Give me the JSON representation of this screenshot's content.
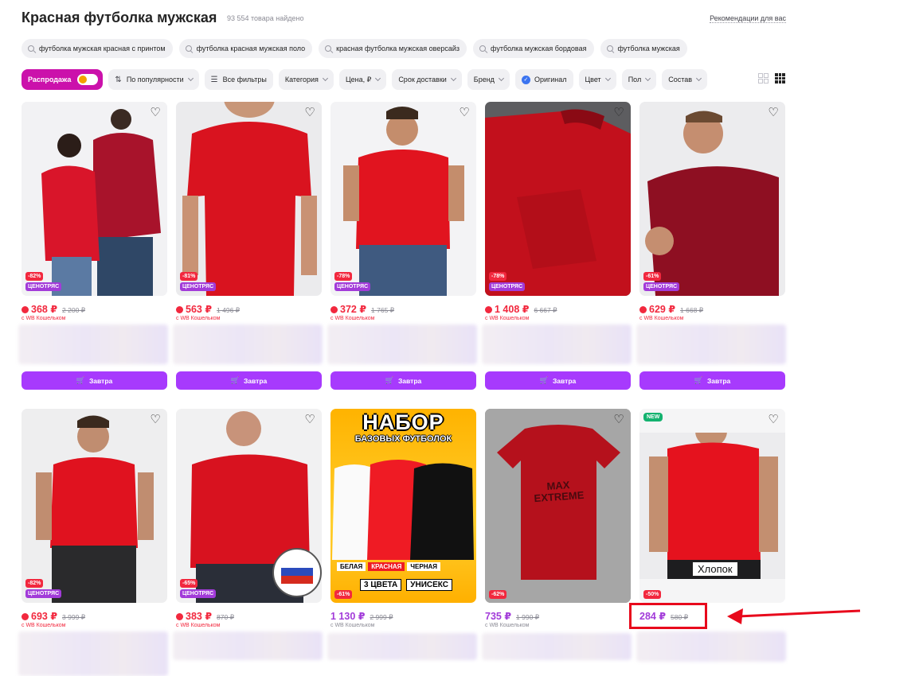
{
  "header": {
    "title": "Красная футболка мужская",
    "count": "93 554 товара найдено",
    "recommend_link": "Рекомендации для вас"
  },
  "suggestions": [
    "футболка мужская красная с принтом",
    "футболка красная мужская поло",
    "красная футболка мужская оверсайз",
    "футболка мужская бордовая",
    "футболка мужская"
  ],
  "filters": {
    "sale": "Распродажа",
    "sort": "По популярности",
    "all_filters": "Все фильтры",
    "category": "Категория",
    "price": "Цена, ₽",
    "delivery": "Срок доставки",
    "brand": "Бренд",
    "original": "Оригинал",
    "color": "Цвет",
    "gender": "Пол",
    "composition": "Состав"
  },
  "labels": {
    "cenotryas": "ЦЕНОТРЯС",
    "wallet": "с WB Кошельком",
    "cart": "Завтра",
    "new": "NEW"
  },
  "row1": [
    {
      "discount": "-82%",
      "price": "368 ₽",
      "old": "2 200 ₽"
    },
    {
      "discount": "-81%",
      "price": "563 ₽",
      "old": "1 496 ₽"
    },
    {
      "discount": "-78%",
      "price": "372 ₽",
      "old": "1 765 ₽"
    },
    {
      "discount": "-78%",
      "price": "1 408 ₽",
      "old": "6 667 ₽"
    },
    {
      "discount": "-61%",
      "price": "629 ₽",
      "old": "1 668 ₽"
    }
  ],
  "row2": [
    {
      "discount": "-82%",
      "price": "693 ₽",
      "old": "3 999 ₽"
    },
    {
      "discount": "-65%",
      "price": "383 ₽",
      "old": "870 ₽"
    },
    {
      "discount": "-61%",
      "price": "1 130 ₽",
      "old": "2 999 ₽",
      "promo_title": "НАБОР",
      "promo_sub": "БАЗОВЫХ ФУТБОЛОК",
      "promo_colors": [
        "БЕЛАЯ",
        "КРАСНАЯ",
        "ЧЕРНАЯ"
      ],
      "promo_bottom": [
        "3 ЦВЕТА",
        "УНИСЕКС"
      ]
    },
    {
      "discount": "-62%",
      "price": "735 ₽",
      "old": "1 990 ₽",
      "print_text": "MAX EXTREME"
    },
    {
      "discount": "-50%",
      "price": "284 ₽",
      "old": "580 ₽",
      "overlay": "Хлопок"
    }
  ],
  "colors": {
    "accent": "#cb11ab",
    "cart": "#a73afd",
    "price_red": "#f2283e",
    "price_purple": "#a23bd9",
    "highlight": "#e8091c"
  }
}
